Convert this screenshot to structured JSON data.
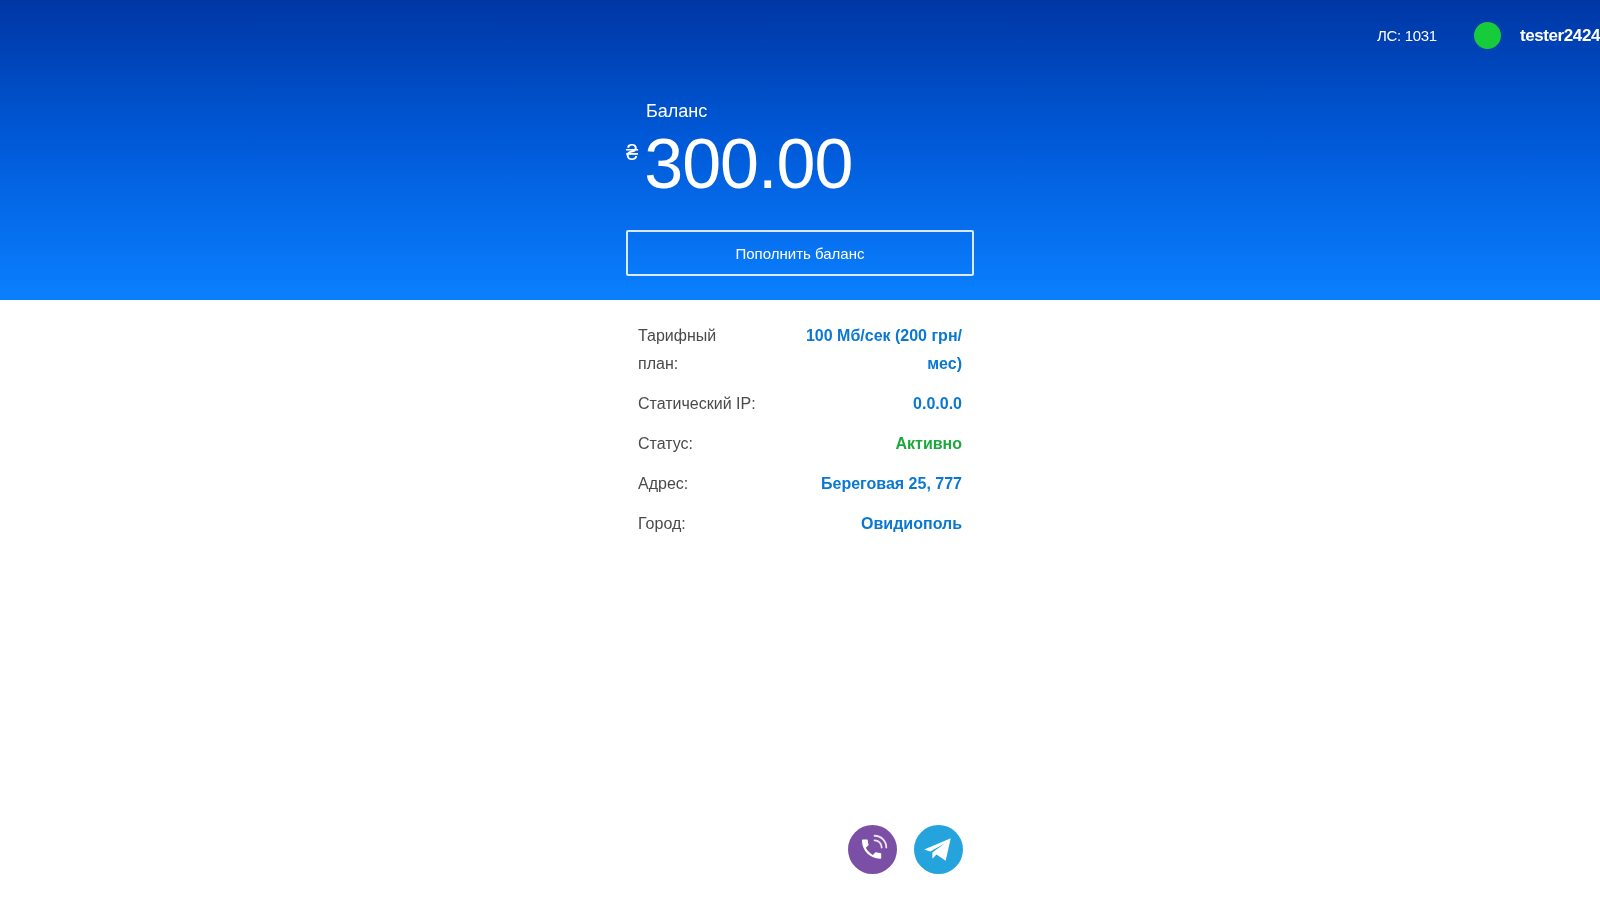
{
  "header": {
    "account": "ЛС: 1031",
    "user": {
      "online": true,
      "name": "tester2424"
    }
  },
  "balance": {
    "label": "Баланс",
    "currency": "₴",
    "amount": "300.00",
    "button": "Пополнить баланс"
  },
  "details": [
    {
      "label": "Тарифный план:",
      "value": "100 Мб/сек (200 грн/мес)",
      "color": "#0a78d2"
    },
    {
      "label": "Статический IP:",
      "value": "0.0.0.0",
      "color": "#0a78d2"
    },
    {
      "label": "Статус:",
      "value": "Активно",
      "color": "#1ca93c"
    },
    {
      "label": "Адрес:",
      "value": "Береговая 25, 777",
      "color": "#0a78d2"
    },
    {
      "label": "Город:",
      "value": "Овидиополь",
      "color": "#0a78d2"
    }
  ],
  "contacts": [
    {
      "kind": "phone"
    },
    {
      "kind": "send"
    }
  ]
}
